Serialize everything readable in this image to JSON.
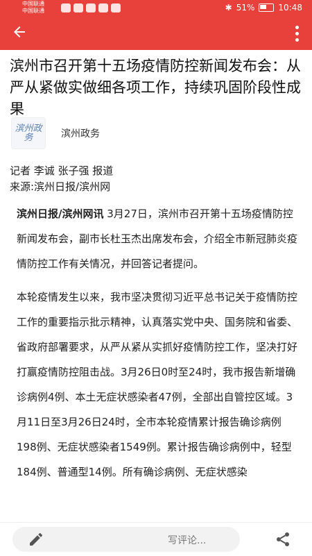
{
  "status_bar": {
    "carrier_1": "中国联通",
    "carrier_2": "中国联通",
    "battery": "51%",
    "time": "10:48"
  },
  "app_bar": {
    "back_icon": "arrow-left-icon",
    "more_icon": "more-vert-icon"
  },
  "article": {
    "title": "滨州市召开第十五场疫情防控新闻发布会：从严从紧做实做细各项工作，持续巩固阶段性成果",
    "source_logo_text": "滨州政务",
    "source_name": "滨州政务",
    "reporter": "记者 李诚 张子强 报道",
    "origin": "来源:滨州日报/滨州网",
    "para1_lead": "滨州日报/滨州网讯",
    "para1_text": " 3月27日，滨州市召开第十五场疫情防控新闻发布会，副市长杜玉杰出席发布会，介绍全市新冠肺炎疫情防控工作有关情况，并回答记者提问。",
    "para2_text": "本轮疫情发生以来，我市坚决贯彻习近平总书记关于疫情防控工作的重要指示批示精神，认真落实党中央、国务院和省委、省政府部署要求，从严从紧从实抓好疫情防控工作，坚决打好打赢疫情防控阻击战。3月26日0时至24时，我市报告新增确诊病例4例、本土无症状感染者47例，全部出自管控区域。3月11日至3月26日24时，全市本轮疫情累计报告确诊病例198例、无症状感染者1549例。累计报告确诊病例中，轻型184例、普通型14例。所有确诊病例、无症状感染"
  },
  "bottom_bar": {
    "comment_placeholder": "写评论...",
    "edit_icon": "pencil-icon",
    "share_icon": "share-icon"
  }
}
